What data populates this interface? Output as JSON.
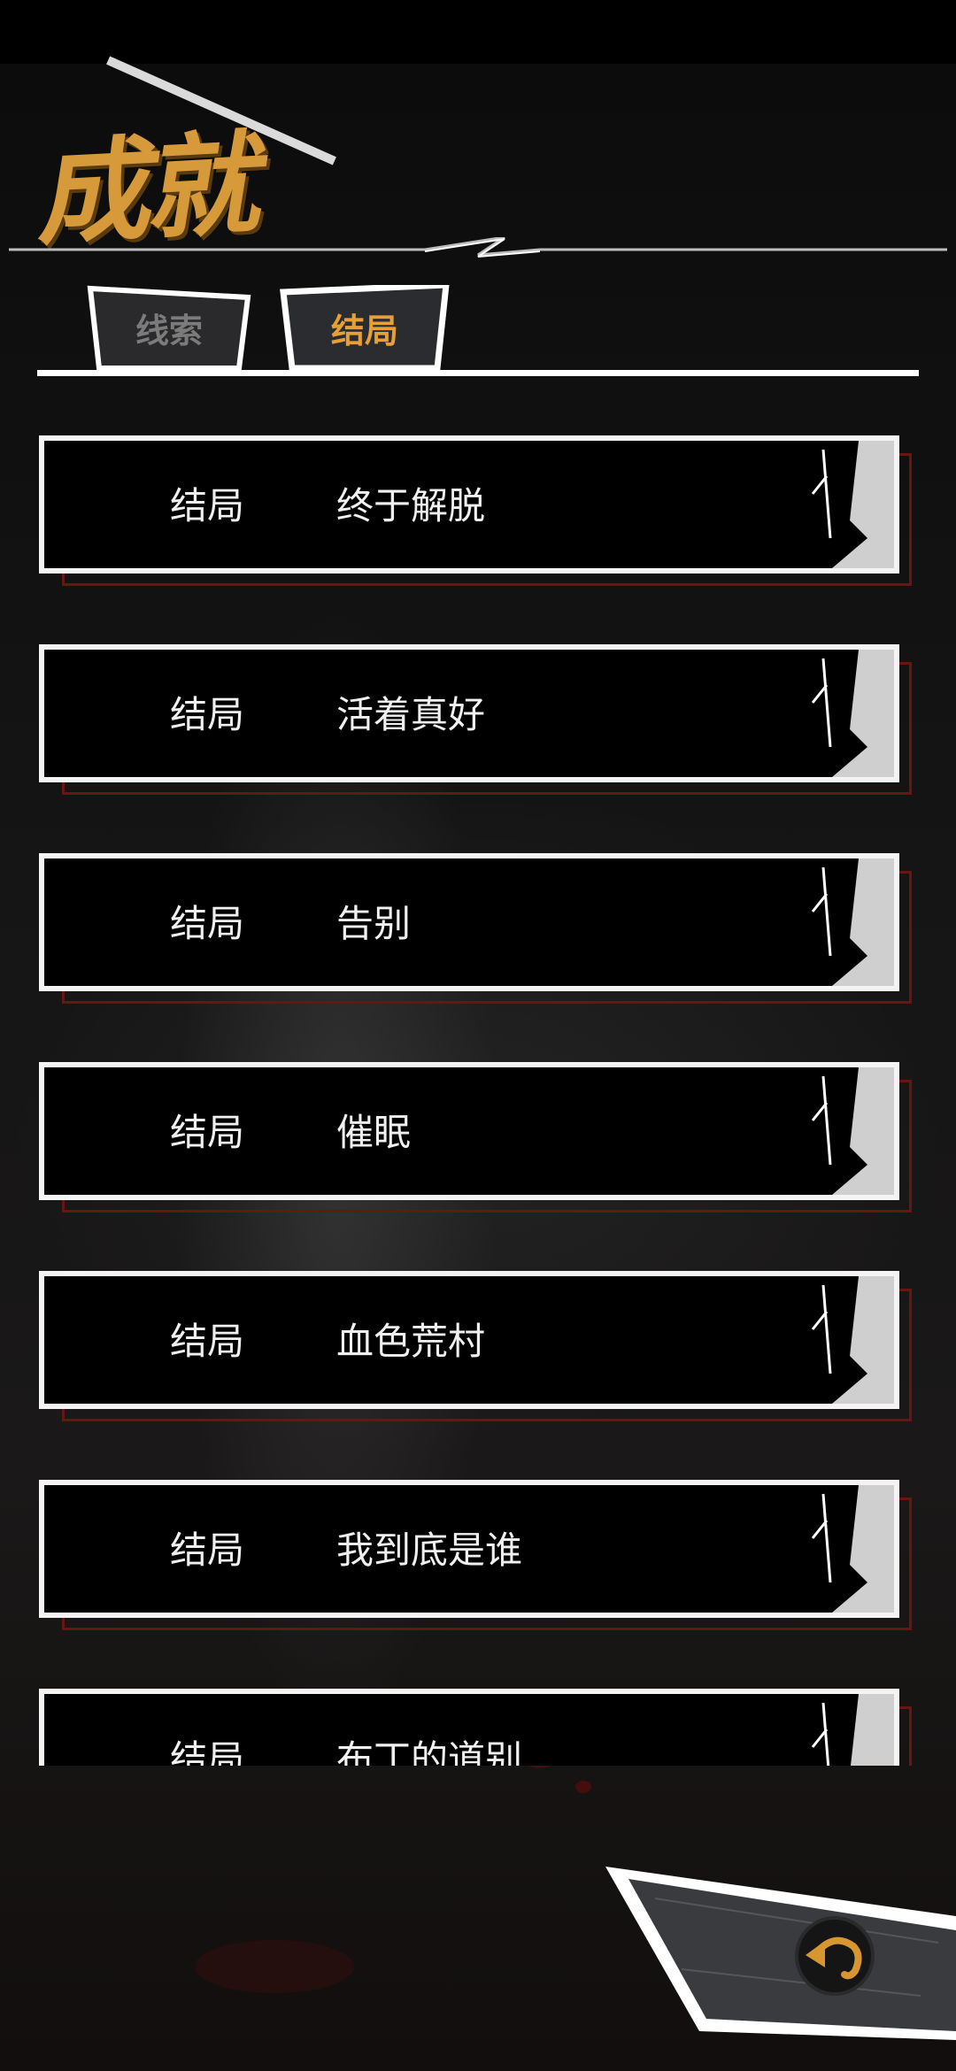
{
  "header": {
    "title": "成就"
  },
  "tabs": [
    {
      "label": "线索",
      "active": false
    },
    {
      "label": "结局",
      "active": true
    }
  ],
  "entries": [
    {
      "category": "结局",
      "name": "终于解脱"
    },
    {
      "category": "结局",
      "name": "活着真好"
    },
    {
      "category": "结局",
      "name": "告别"
    },
    {
      "category": "结局",
      "name": "催眠"
    },
    {
      "category": "结局",
      "name": "血色荒村"
    },
    {
      "category": "结局",
      "name": "我到底是谁"
    },
    {
      "category": "结局",
      "name": "布丁的道别"
    }
  ],
  "icons": {
    "back": "back-arrow-icon"
  },
  "colors": {
    "accent": "#e8a035",
    "title": "#d79a3a",
    "inactive_tab": "#7b7b7b",
    "card_shadow": "#6b1414",
    "card_border": "#f4f4f4"
  }
}
